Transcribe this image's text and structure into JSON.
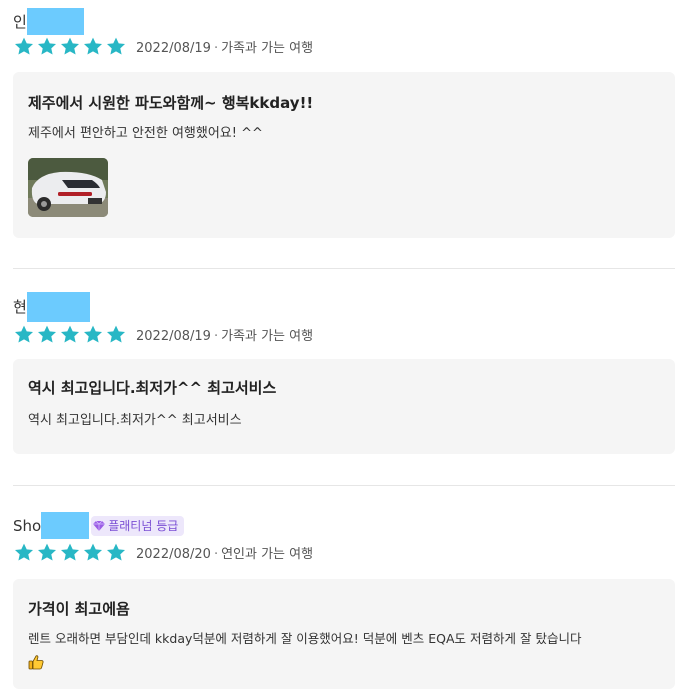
{
  "reviews": [
    {
      "name_prefix": "인",
      "date": "2022/08/19",
      "separator": "·",
      "trip_type": "가족과 가는 여행",
      "title": "제주에서 시원한 파도와함께~ 행복kkday!!",
      "text": "제주에서 편안하고 안전한 여행했어요! ^^",
      "rating": 5
    },
    {
      "name_prefix": "현",
      "date": "2022/08/19",
      "separator": "·",
      "trip_type": "가족과 가는 여행",
      "title": "역시 최고입니다.최저가^^ 최고서비스",
      "text": "역시 최고입니다.최저가^^ 최고서비스",
      "rating": 5
    },
    {
      "name_prefix": "Sho",
      "badge": "플래티넘 등급",
      "date": "2022/08/20",
      "separator": "·",
      "trip_type": "연인과 가는 여행",
      "title": "가격이 최고에욤",
      "text": "렌트 오래하면 부담인데 kkday덕분에 저렴하게 잘 이용했어요! 덕분에 벤츠 EQA도 저렴하게 잘 탔습니다",
      "rating": 5
    }
  ],
  "colors": {
    "star": "#28b7c5",
    "name_mask": "#6ccbfe",
    "card_bg": "#f5f5f5",
    "badge_bg": "#ede7fb",
    "badge_text": "#7a4ed4"
  }
}
